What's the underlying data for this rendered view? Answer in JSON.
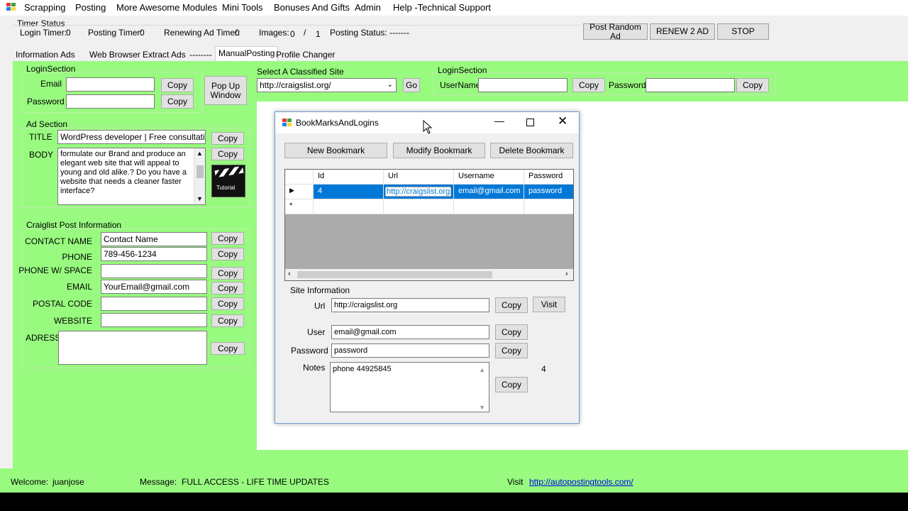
{
  "menu": {
    "items": [
      "Scrapping",
      "Posting",
      "More Awesome Modules",
      "Mini Tools",
      "Bonuses And Gifts",
      "Admin",
      "Help -Technical Support"
    ]
  },
  "timer": {
    "title": "Timer Status",
    "login_label": "Login Timer:",
    "login_value": "0",
    "posting_label": "Posting Timer:",
    "posting_value": "0",
    "renew_label": "Renewing Ad Timer:",
    "renew_value": "0",
    "images_label": "Images:",
    "images_value": "0",
    "images_sep": "/",
    "images_total": "1",
    "status_label": "Posting Status:",
    "status_value": "-------"
  },
  "top_buttons": {
    "post_random": "Post Random Ad",
    "renew": "RENEW 2 AD",
    "stop": "STOP"
  },
  "tabs": [
    "Information",
    "Ads",
    "Web Browser",
    "Extract Ads",
    "--------",
    "ManualPosting",
    "Profile Changer"
  ],
  "login_left": {
    "title": "LoginSection",
    "email_label": "Email",
    "email_value": "",
    "copy": "Copy",
    "password_label": "Password",
    "password_value": "",
    "popup_label": "Pop Up Window"
  },
  "classified": {
    "label": "Select A Classified Site",
    "value": "http://craigslist.org/",
    "go": "Go"
  },
  "login_right": {
    "title": "LoginSection",
    "username_label": "UserName",
    "password_label": "Password",
    "copy": "Copy"
  },
  "ad": {
    "title": "Ad Section",
    "title_label": "TITLE",
    "title_value": "WordPress developer | Free consultation",
    "body_label": "BODY",
    "body_value": "formulate our Brand and produce an elegant web site that will appeal to young and old alike.? Do you have a website that needs a cleaner faster interface?",
    "tutorial": "Tutorial",
    "copy": "Copy"
  },
  "craigslist": {
    "title": "Craiglist Post Information",
    "fields": [
      {
        "label": "CONTACT NAME",
        "value": "Contact Name"
      },
      {
        "label": "PHONE",
        "value": "789-456-1234"
      },
      {
        "label": "PHONE W/ SPACE",
        "value": ""
      },
      {
        "label": "EMAIL",
        "value": "YourEmail@gmail.com"
      },
      {
        "label": "POSTAL CODE",
        "value": ""
      },
      {
        "label": "WEBSITE",
        "value": ""
      }
    ],
    "address_label": "ADRESS",
    "copy": "Copy"
  },
  "dialog": {
    "title": "BookMarksAndLogins",
    "buttons": {
      "new": "New Bookmark",
      "modify": "Modify Bookmark",
      "delete": "Delete Bookmark"
    },
    "grid": {
      "columns": [
        "Id",
        "Url",
        "Username",
        "Password"
      ],
      "rows": [
        {
          "id": "4",
          "url": "http://craigslist.org",
          "username": "email@gmail.com",
          "password": "password"
        }
      ],
      "new_row_marker": "*"
    },
    "site_info": {
      "title": "Site Information",
      "url_label": "Url",
      "url_value": "http://craigslist.org",
      "user_label": "User",
      "user_value": "email@gmail.com",
      "password_label": "Password",
      "password_value": "password",
      "notes_label": "Notes",
      "notes_value": "phone 44925845",
      "count": "4",
      "copy": "Copy",
      "visit": "Visit"
    }
  },
  "status": {
    "welcome_label": "Welcome:",
    "welcome_user": "juanjose",
    "message_label": "Message:",
    "message_value": "FULL ACCESS - LIFE TIME UPDATES",
    "visit_label": "Visit",
    "visit_link": "http://autopostingtools.com/"
  },
  "colors": {
    "green": "#98fb7f",
    "selection": "#0078d7",
    "link": "#0000ee"
  }
}
